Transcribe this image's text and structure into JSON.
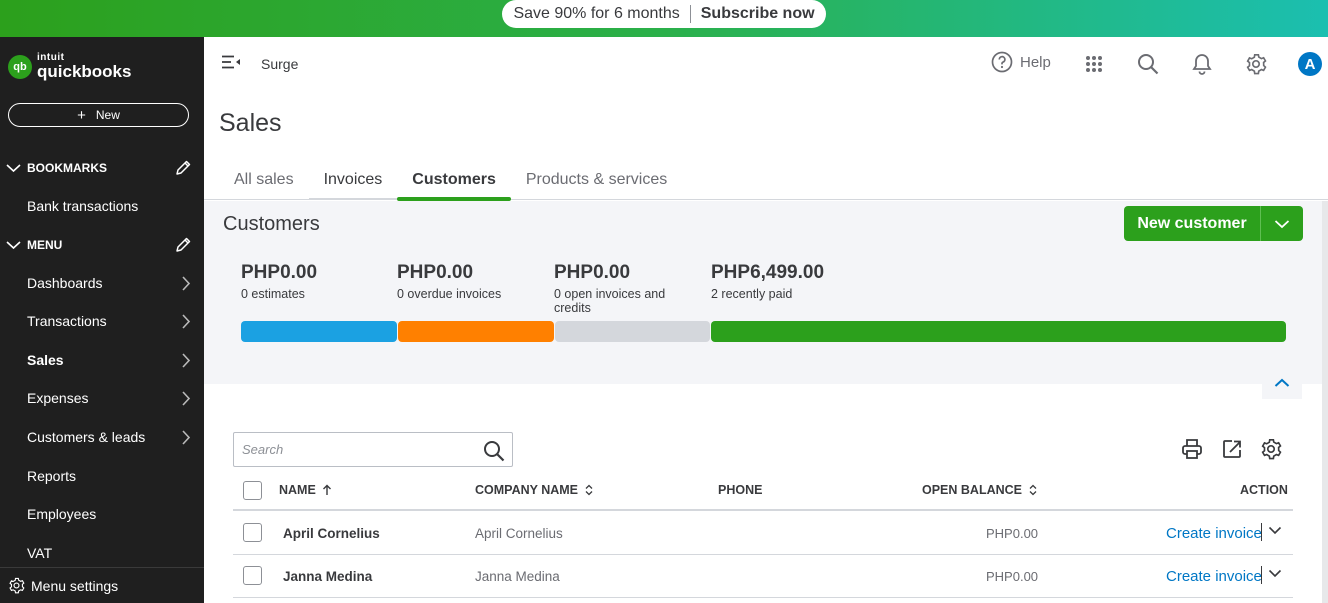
{
  "promo": {
    "offer": "Save 90% for 6 months",
    "cta": "Subscribe now"
  },
  "sidebar": {
    "logo_small": "intuit",
    "logo_big": "quickbooks",
    "logo_mark": "qb",
    "new_label": "New",
    "bookmarks_label": "BOOKMARKS",
    "bookmark_items": [
      {
        "label": "Bank transactions"
      }
    ],
    "menu_label": "MENU",
    "menu_items": [
      {
        "label": "Dashboards",
        "has_arrow": true
      },
      {
        "label": "Transactions",
        "has_arrow": true
      },
      {
        "label": "Sales",
        "has_arrow": true,
        "active": true
      },
      {
        "label": "Expenses",
        "has_arrow": true
      },
      {
        "label": "Customers & leads",
        "has_arrow": true
      },
      {
        "label": "Reports",
        "has_arrow": false
      },
      {
        "label": "Employees",
        "has_arrow": false
      },
      {
        "label": "VAT",
        "has_arrow": false
      }
    ],
    "menu_settings": "Menu settings"
  },
  "topbar": {
    "company": "Surge",
    "help": "Help",
    "avatar_initial": "A"
  },
  "page": {
    "title": "Sales"
  },
  "tabs": [
    {
      "label": "All sales"
    },
    {
      "label": "Invoices"
    },
    {
      "label": "Customers",
      "active": true
    },
    {
      "label": "Products & services"
    }
  ],
  "summary": {
    "title": "Customers",
    "new_button": "New customer",
    "stats": [
      {
        "amount": "PHP0.00",
        "desc": "0 estimates",
        "color": "#1ba1e2"
      },
      {
        "amount": "PHP0.00",
        "desc": "0 overdue invoices",
        "color": "#ff8000"
      },
      {
        "amount": "PHP0.00",
        "desc": "0 open invoices and credits",
        "color": "#d4d7dc"
      },
      {
        "amount": "PHP6,499.00",
        "desc": "2 recently paid",
        "color": "#2ca01c"
      }
    ]
  },
  "table": {
    "search_placeholder": "Search",
    "columns": {
      "name": "NAME",
      "company": "COMPANY NAME",
      "phone": "PHONE",
      "balance": "OPEN BALANCE",
      "action": "ACTION"
    },
    "rows": [
      {
        "name": "April Cornelius",
        "company": "April Cornelius",
        "phone": "",
        "balance": "PHP0.00",
        "action": "Create invoice"
      },
      {
        "name": "Janna Medina",
        "company": "Janna Medina",
        "phone": "",
        "balance": "PHP0.00",
        "action": "Create invoice"
      }
    ]
  },
  "colors": {
    "brand_green": "#2ca01c",
    "link_blue": "#0077c5",
    "sidebar_bg": "#1f1f1f"
  }
}
